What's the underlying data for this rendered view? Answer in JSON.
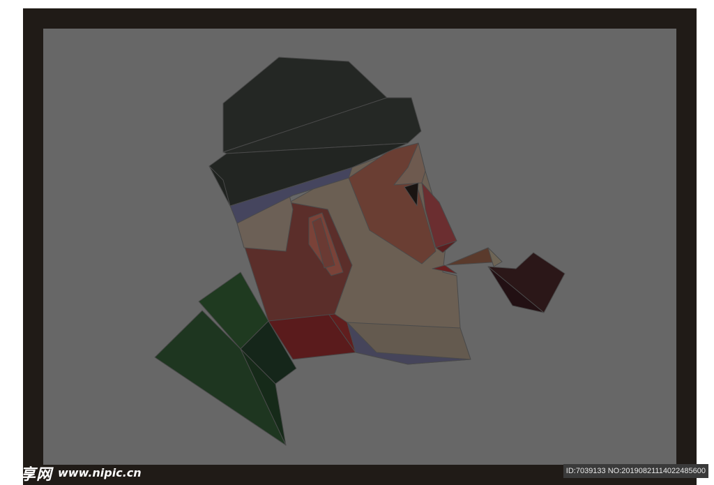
{
  "image": {
    "subject": "Low-poly portrait of a man with beanie and pipe",
    "colors": {
      "background": "#ffffff",
      "frame": "#201b17",
      "canvas": "#676767",
      "beanie": "#262626",
      "skin": "#6b5f53",
      "coat": "#1e3620",
      "pipe": "#2b1718"
    }
  },
  "watermark": {
    "logo": "昵享网",
    "site": "www.nipic.cn",
    "id_text": "ID:7039133 NO:20190821114022485600"
  }
}
